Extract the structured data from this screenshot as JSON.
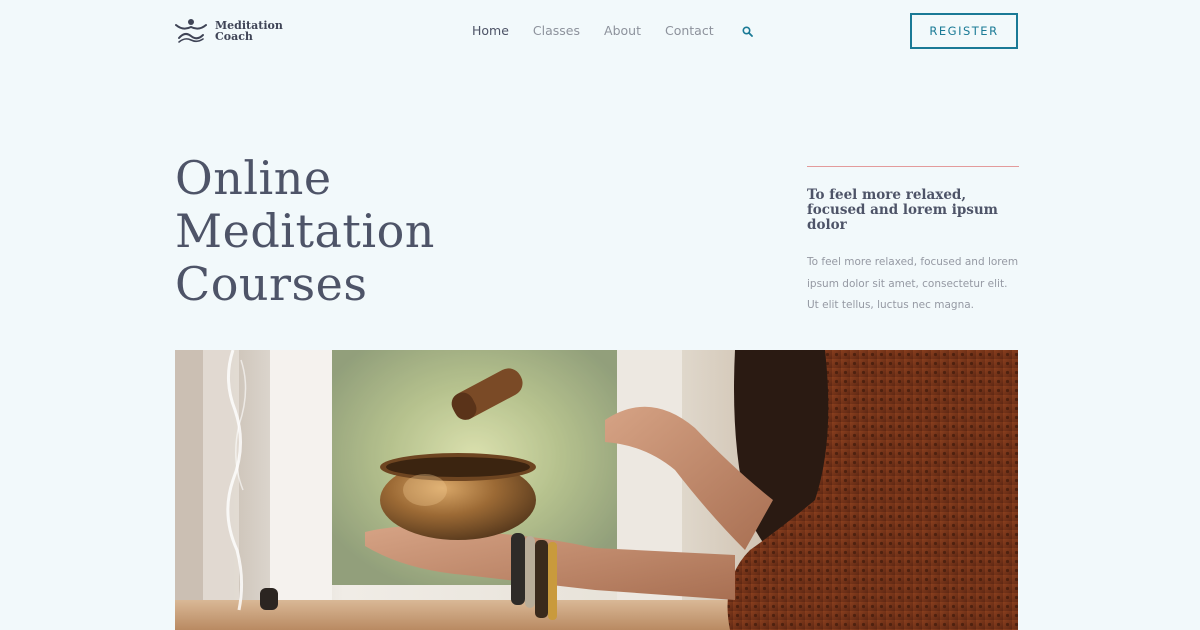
{
  "header": {
    "logo": {
      "line1": "Meditation",
      "line2": "Coach",
      "icon": "meditation-figure-icon"
    },
    "nav": [
      {
        "label": "Home",
        "active": true
      },
      {
        "label": "Classes",
        "active": false
      },
      {
        "label": "About",
        "active": false
      },
      {
        "label": "Contact",
        "active": false
      }
    ],
    "search_icon": "search-icon",
    "register_label": "REGISTER"
  },
  "hero": {
    "title_lines": [
      "Online",
      "Meditation",
      "Courses"
    ]
  },
  "aside": {
    "heading": "To feel more relaxed, focused and lorem ipsum dolor",
    "body": "To feel more relaxed, focused and lorem ipsum dolor sit amet, consectetur elit. Ut elit tellus, luctus nec magna."
  },
  "colors": {
    "background": "#f2f9fb",
    "accent": "#1a7a96",
    "divider": "#e39b9b",
    "heading": "#4e5468",
    "muted": "#9599a3"
  }
}
